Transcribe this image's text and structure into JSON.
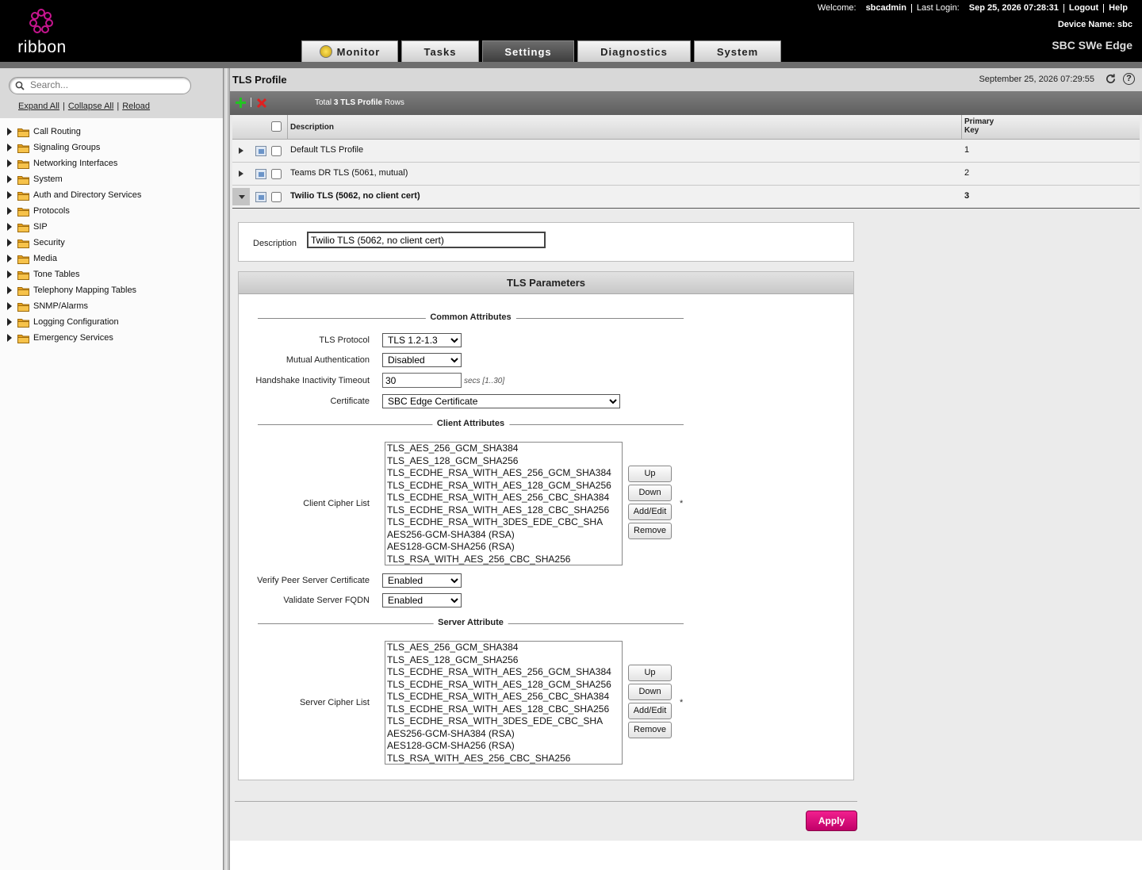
{
  "header": {
    "logo_text": "ribbon",
    "welcome_label": "Welcome:",
    "user": "sbcadmin",
    "last_login_label": "Last Login:",
    "last_login": "Sep 25, 2026 07:28:31",
    "logout": "Logout",
    "help": "Help",
    "device_name_label": "Device Name:",
    "device_name": "sbc",
    "product": "SBC SWe Edge",
    "tabs": [
      "Monitor",
      "Tasks",
      "Settings",
      "Diagnostics",
      "System"
    ],
    "active_tab": "Settings"
  },
  "sidebar": {
    "search_placeholder": "Search...",
    "expand_all": "Expand All",
    "collapse_all": "Collapse All",
    "reload": "Reload",
    "items": [
      "Call Routing",
      "Signaling Groups",
      "Networking Interfaces",
      "System",
      "Auth and Directory Services",
      "Protocols",
      "SIP",
      "Security",
      "Media",
      "Tone Tables",
      "Telephony Mapping Tables",
      "SNMP/Alarms",
      "Logging Configuration",
      "Emergency Services"
    ]
  },
  "page": {
    "title": "TLS Profile",
    "datetime": "September 25, 2026 07:29:55",
    "total_prefix": "Total",
    "total_count": "3 TLS Profile",
    "total_suffix": "Rows",
    "col_description": "Description",
    "col_key_line1": "Primary",
    "col_key_line2": "Key",
    "rows": [
      {
        "description": "Default TLS Profile",
        "key": "1"
      },
      {
        "description": "Teams DR TLS (5061, mutual)",
        "key": "2"
      },
      {
        "description": "Twilio TLS (5062, no client cert)",
        "key": "3"
      }
    ]
  },
  "form": {
    "description_label": "Description",
    "description_value": "Twilio TLS (5062, no client cert)",
    "panel_title": "TLS Parameters",
    "common_attributes": "Common Attributes",
    "tls_protocol_label": "TLS Protocol",
    "tls_protocol_value": "TLS 1.2-1.3",
    "mutual_auth_label": "Mutual Authentication",
    "mutual_auth_value": "Disabled",
    "handshake_label": "Handshake Inactivity Timeout",
    "handshake_value": "30",
    "handshake_hint": "secs [1..30]",
    "certificate_label": "Certificate",
    "certificate_value": "SBC Edge Certificate",
    "client_attributes": "Client Attributes",
    "client_cipher_label": "Client Cipher List",
    "verify_peer_label": "Verify Peer Server Certificate",
    "verify_peer_value": "Enabled",
    "validate_fqdn_label": "Validate Server FQDN",
    "validate_fqdn_value": "Enabled",
    "server_attribute": "Server Attribute",
    "server_cipher_label": "Server Cipher List",
    "required_marker": "*",
    "buttons": {
      "up": "Up",
      "down": "Down",
      "add_edit": "Add/Edit",
      "remove": "Remove"
    },
    "ciphers": [
      "TLS_AES_256_GCM_SHA384",
      "TLS_AES_128_GCM_SHA256",
      "TLS_ECDHE_RSA_WITH_AES_256_GCM_SHA384",
      "TLS_ECDHE_RSA_WITH_AES_128_GCM_SHA256",
      "TLS_ECDHE_RSA_WITH_AES_256_CBC_SHA384",
      "TLS_ECDHE_RSA_WITH_AES_128_CBC_SHA256",
      "TLS_ECDHE_RSA_WITH_3DES_EDE_CBC_SHA",
      "AES256-GCM-SHA384 (RSA)",
      "AES128-GCM-SHA256 (RSA)",
      "TLS_RSA_WITH_AES_256_CBC_SHA256"
    ],
    "apply": "Apply"
  },
  "colors": {
    "brand": "#e4007c",
    "apply": "#e0157f"
  }
}
